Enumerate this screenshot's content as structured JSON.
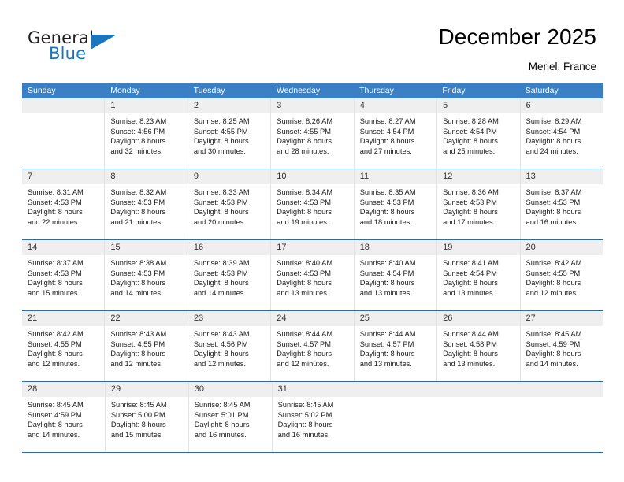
{
  "logo": {
    "primary_text": "General",
    "secondary_text": "Blue",
    "accent_color": "#1b75bb",
    "triangle_icon": "triangle-icon"
  },
  "header": {
    "title": "December 2025",
    "subtitle": "Meriel, France"
  },
  "colors": {
    "header_row_bg": "#3b7fc4",
    "daynum_band_bg": "#efefef",
    "week_separator": "#2e6da4",
    "cell_divider": "#e3e3e3"
  },
  "weekdays": [
    "Sunday",
    "Monday",
    "Tuesday",
    "Wednesday",
    "Thursday",
    "Friday",
    "Saturday"
  ],
  "weeks": [
    [
      {
        "day": "",
        "empty": true
      },
      {
        "day": "1",
        "sunrise": "Sunrise: 8:23 AM",
        "sunset": "Sunset: 4:56 PM",
        "daylight_line1": "Daylight: 8 hours",
        "daylight_line2": "and 32 minutes."
      },
      {
        "day": "2",
        "sunrise": "Sunrise: 8:25 AM",
        "sunset": "Sunset: 4:55 PM",
        "daylight_line1": "Daylight: 8 hours",
        "daylight_line2": "and 30 minutes."
      },
      {
        "day": "3",
        "sunrise": "Sunrise: 8:26 AM",
        "sunset": "Sunset: 4:55 PM",
        "daylight_line1": "Daylight: 8 hours",
        "daylight_line2": "and 28 minutes."
      },
      {
        "day": "4",
        "sunrise": "Sunrise: 8:27 AM",
        "sunset": "Sunset: 4:54 PM",
        "daylight_line1": "Daylight: 8 hours",
        "daylight_line2": "and 27 minutes."
      },
      {
        "day": "5",
        "sunrise": "Sunrise: 8:28 AM",
        "sunset": "Sunset: 4:54 PM",
        "daylight_line1": "Daylight: 8 hours",
        "daylight_line2": "and 25 minutes."
      },
      {
        "day": "6",
        "sunrise": "Sunrise: 8:29 AM",
        "sunset": "Sunset: 4:54 PM",
        "daylight_line1": "Daylight: 8 hours",
        "daylight_line2": "and 24 minutes."
      }
    ],
    [
      {
        "day": "7",
        "sunrise": "Sunrise: 8:31 AM",
        "sunset": "Sunset: 4:53 PM",
        "daylight_line1": "Daylight: 8 hours",
        "daylight_line2": "and 22 minutes."
      },
      {
        "day": "8",
        "sunrise": "Sunrise: 8:32 AM",
        "sunset": "Sunset: 4:53 PM",
        "daylight_line1": "Daylight: 8 hours",
        "daylight_line2": "and 21 minutes."
      },
      {
        "day": "9",
        "sunrise": "Sunrise: 8:33 AM",
        "sunset": "Sunset: 4:53 PM",
        "daylight_line1": "Daylight: 8 hours",
        "daylight_line2": "and 20 minutes."
      },
      {
        "day": "10",
        "sunrise": "Sunrise: 8:34 AM",
        "sunset": "Sunset: 4:53 PM",
        "daylight_line1": "Daylight: 8 hours",
        "daylight_line2": "and 19 minutes."
      },
      {
        "day": "11",
        "sunrise": "Sunrise: 8:35 AM",
        "sunset": "Sunset: 4:53 PM",
        "daylight_line1": "Daylight: 8 hours",
        "daylight_line2": "and 18 minutes."
      },
      {
        "day": "12",
        "sunrise": "Sunrise: 8:36 AM",
        "sunset": "Sunset: 4:53 PM",
        "daylight_line1": "Daylight: 8 hours",
        "daylight_line2": "and 17 minutes."
      },
      {
        "day": "13",
        "sunrise": "Sunrise: 8:37 AM",
        "sunset": "Sunset: 4:53 PM",
        "daylight_line1": "Daylight: 8 hours",
        "daylight_line2": "and 16 minutes."
      }
    ],
    [
      {
        "day": "14",
        "sunrise": "Sunrise: 8:37 AM",
        "sunset": "Sunset: 4:53 PM",
        "daylight_line1": "Daylight: 8 hours",
        "daylight_line2": "and 15 minutes."
      },
      {
        "day": "15",
        "sunrise": "Sunrise: 8:38 AM",
        "sunset": "Sunset: 4:53 PM",
        "daylight_line1": "Daylight: 8 hours",
        "daylight_line2": "and 14 minutes."
      },
      {
        "day": "16",
        "sunrise": "Sunrise: 8:39 AM",
        "sunset": "Sunset: 4:53 PM",
        "daylight_line1": "Daylight: 8 hours",
        "daylight_line2": "and 14 minutes."
      },
      {
        "day": "17",
        "sunrise": "Sunrise: 8:40 AM",
        "sunset": "Sunset: 4:53 PM",
        "daylight_line1": "Daylight: 8 hours",
        "daylight_line2": "and 13 minutes."
      },
      {
        "day": "18",
        "sunrise": "Sunrise: 8:40 AM",
        "sunset": "Sunset: 4:54 PM",
        "daylight_line1": "Daylight: 8 hours",
        "daylight_line2": "and 13 minutes."
      },
      {
        "day": "19",
        "sunrise": "Sunrise: 8:41 AM",
        "sunset": "Sunset: 4:54 PM",
        "daylight_line1": "Daylight: 8 hours",
        "daylight_line2": "and 13 minutes."
      },
      {
        "day": "20",
        "sunrise": "Sunrise: 8:42 AM",
        "sunset": "Sunset: 4:55 PM",
        "daylight_line1": "Daylight: 8 hours",
        "daylight_line2": "and 12 minutes."
      }
    ],
    [
      {
        "day": "21",
        "sunrise": "Sunrise: 8:42 AM",
        "sunset": "Sunset: 4:55 PM",
        "daylight_line1": "Daylight: 8 hours",
        "daylight_line2": "and 12 minutes."
      },
      {
        "day": "22",
        "sunrise": "Sunrise: 8:43 AM",
        "sunset": "Sunset: 4:55 PM",
        "daylight_line1": "Daylight: 8 hours",
        "daylight_line2": "and 12 minutes."
      },
      {
        "day": "23",
        "sunrise": "Sunrise: 8:43 AM",
        "sunset": "Sunset: 4:56 PM",
        "daylight_line1": "Daylight: 8 hours",
        "daylight_line2": "and 12 minutes."
      },
      {
        "day": "24",
        "sunrise": "Sunrise: 8:44 AM",
        "sunset": "Sunset: 4:57 PM",
        "daylight_line1": "Daylight: 8 hours",
        "daylight_line2": "and 12 minutes."
      },
      {
        "day": "25",
        "sunrise": "Sunrise: 8:44 AM",
        "sunset": "Sunset: 4:57 PM",
        "daylight_line1": "Daylight: 8 hours",
        "daylight_line2": "and 13 minutes."
      },
      {
        "day": "26",
        "sunrise": "Sunrise: 8:44 AM",
        "sunset": "Sunset: 4:58 PM",
        "daylight_line1": "Daylight: 8 hours",
        "daylight_line2": "and 13 minutes."
      },
      {
        "day": "27",
        "sunrise": "Sunrise: 8:45 AM",
        "sunset": "Sunset: 4:59 PM",
        "daylight_line1": "Daylight: 8 hours",
        "daylight_line2": "and 14 minutes."
      }
    ],
    [
      {
        "day": "28",
        "sunrise": "Sunrise: 8:45 AM",
        "sunset": "Sunset: 4:59 PM",
        "daylight_line1": "Daylight: 8 hours",
        "daylight_line2": "and 14 minutes."
      },
      {
        "day": "29",
        "sunrise": "Sunrise: 8:45 AM",
        "sunset": "Sunset: 5:00 PM",
        "daylight_line1": "Daylight: 8 hours",
        "daylight_line2": "and 15 minutes."
      },
      {
        "day": "30",
        "sunrise": "Sunrise: 8:45 AM",
        "sunset": "Sunset: 5:01 PM",
        "daylight_line1": "Daylight: 8 hours",
        "daylight_line2": "and 16 minutes."
      },
      {
        "day": "31",
        "sunrise": "Sunrise: 8:45 AM",
        "sunset": "Sunset: 5:02 PM",
        "daylight_line1": "Daylight: 8 hours",
        "daylight_line2": "and 16 minutes."
      },
      {
        "day": "",
        "empty": true
      },
      {
        "day": "",
        "empty": true
      },
      {
        "day": "",
        "empty": true
      }
    ]
  ]
}
